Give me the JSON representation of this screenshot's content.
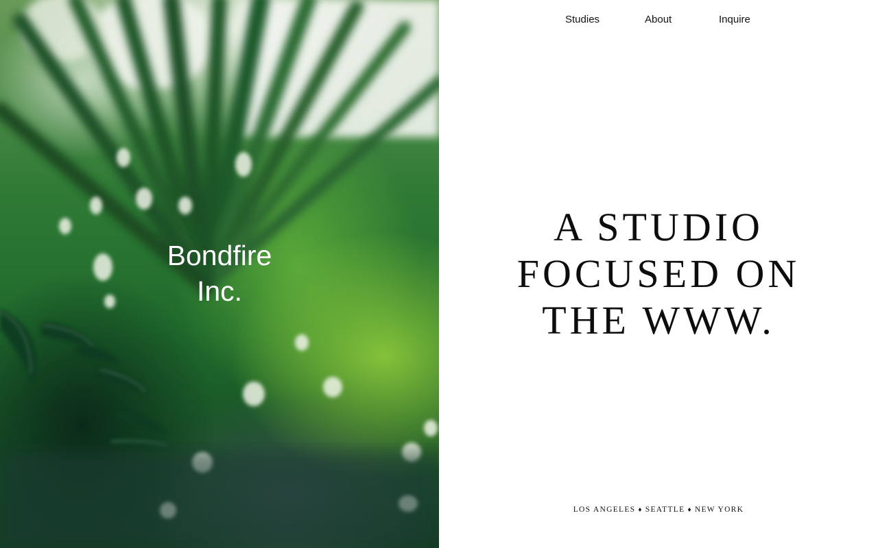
{
  "brand": {
    "line1": "Bondfire",
    "line2": "Inc."
  },
  "hero_image": {
    "description_icon": "palm-leaves-photo"
  },
  "nav": {
    "items": [
      {
        "label": "Studies"
      },
      {
        "label": "About"
      },
      {
        "label": "Inquire"
      }
    ]
  },
  "headline": {
    "line1": "A STUDIO",
    "line2": "FOCUSED ON",
    "line3": "THE WWW."
  },
  "locations": {
    "cities": [
      "LOS ANGELES",
      "SEATTLE",
      "NEW YORK"
    ],
    "separator": "♦"
  },
  "colors": {
    "text": "#0d0d0d",
    "background": "#ffffff",
    "hero_green": "#2f7a35"
  }
}
